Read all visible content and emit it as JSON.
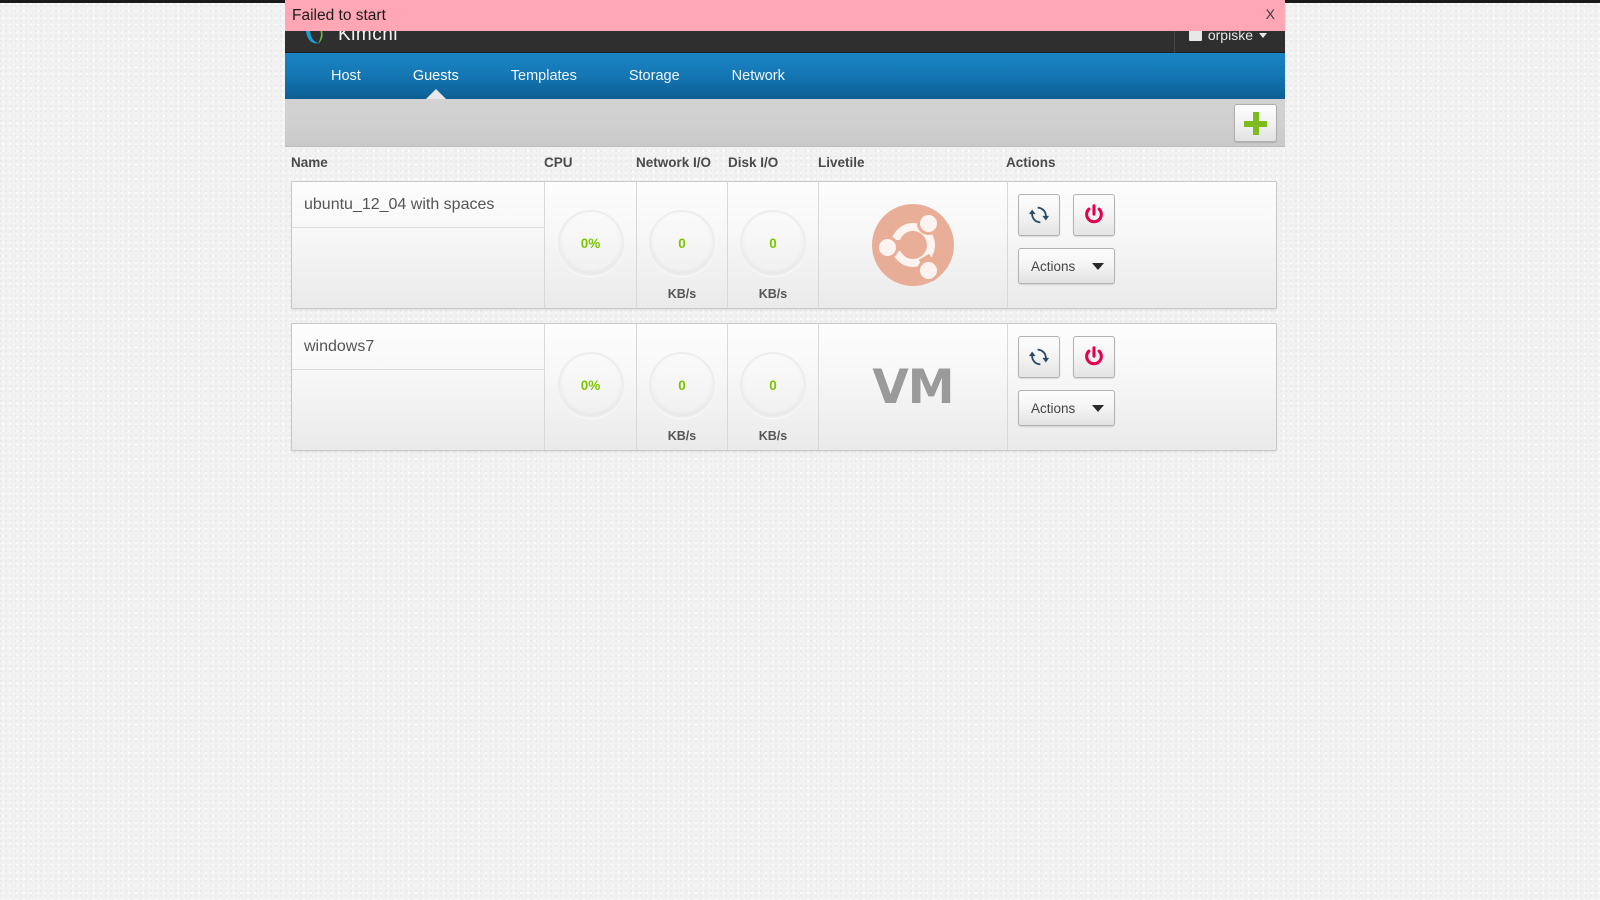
{
  "alert": {
    "message": "Failed to start",
    "close_label": "X",
    "background_color": "#ffa7b5"
  },
  "header": {
    "brand_name": "Kimchi",
    "brand_logo_icon": "kimchi-logo-icon",
    "user_name": "orpiske",
    "user_icon": "user-icon",
    "caret_icon": "chevron-down-icon"
  },
  "nav": {
    "items": [
      {
        "label": "Host",
        "active": false
      },
      {
        "label": "Guests",
        "active": true
      },
      {
        "label": "Templates",
        "active": false
      },
      {
        "label": "Storage",
        "active": false
      },
      {
        "label": "Network",
        "active": false
      }
    ]
  },
  "toolbar": {
    "add_label": "+",
    "add_icon": "plus-icon",
    "accent_color": "#7dbb1e"
  },
  "table": {
    "columns": {
      "name": "Name",
      "cpu": "CPU",
      "network_io": "Network I/O",
      "disk_io": "Disk I/O",
      "livetile": "Livetile",
      "actions": "Actions"
    }
  },
  "guests": [
    {
      "name": "ubuntu_12_04 with spaces",
      "cpu": "0%",
      "network_io": "0",
      "network_unit": "KB/s",
      "disk_io": "0",
      "disk_unit": "KB/s",
      "livetile_icon": "ubuntu-logo-icon",
      "livetile_label": "",
      "reset_icon": "reset-icon",
      "power_icon": "power-icon",
      "actions_label": "Actions"
    },
    {
      "name": "windows7",
      "cpu": "0%",
      "network_io": "0",
      "network_unit": "KB/s",
      "disk_io": "0",
      "disk_unit": "KB/s",
      "livetile_icon": "vm-placeholder-icon",
      "livetile_label": "VM",
      "reset_icon": "reset-icon",
      "power_icon": "power-icon",
      "actions_label": "Actions"
    }
  ],
  "colors": {
    "gauge_value": "#7dc400",
    "nav_blue": "#1578b5",
    "power_red": "#e4004f",
    "reset_blue": "#2b4a66",
    "header_dark": "#2f2f2f"
  }
}
